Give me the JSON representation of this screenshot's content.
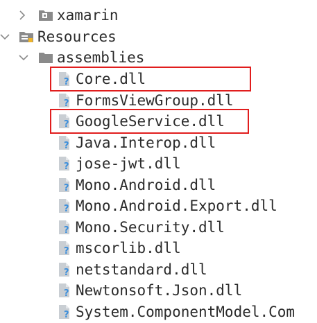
{
  "tree": {
    "xamarin": {
      "label": "xamarin",
      "icon": "folder-package-icon",
      "expanded": false
    },
    "resources": {
      "label": "Resources",
      "icon": "resources-folder-icon",
      "expanded": true
    },
    "assemblies": {
      "label": "assemblies",
      "icon": "folder-icon",
      "expanded": true,
      "files": [
        {
          "label": "Core.dll",
          "highlighted": true
        },
        {
          "label": "FormsViewGroup.dll",
          "highlighted": false
        },
        {
          "label": "GoogleService.dll",
          "highlighted": true
        },
        {
          "label": "Java.Interop.dll",
          "highlighted": false
        },
        {
          "label": "jose-jwt.dll",
          "highlighted": false
        },
        {
          "label": "Mono.Android.dll",
          "highlighted": false
        },
        {
          "label": "Mono.Android.Export.dll",
          "highlighted": false
        },
        {
          "label": "Mono.Security.dll",
          "highlighted": false
        },
        {
          "label": "mscorlib.dll",
          "highlighted": false
        },
        {
          "label": "netstandard.dll",
          "highlighted": false
        },
        {
          "label": "Newtonsoft.Json.dll",
          "highlighted": false
        },
        {
          "label": "System.ComponentModel.Com",
          "highlighted": false
        }
      ]
    }
  },
  "colors": {
    "highlight": "#e11d1d",
    "text": "#2b2b2b",
    "chevron": "#8c8c8c",
    "folder": "#8a8a8a",
    "file_icon": "#9aa0a6",
    "unknown_badge": "#3b8edb"
  }
}
